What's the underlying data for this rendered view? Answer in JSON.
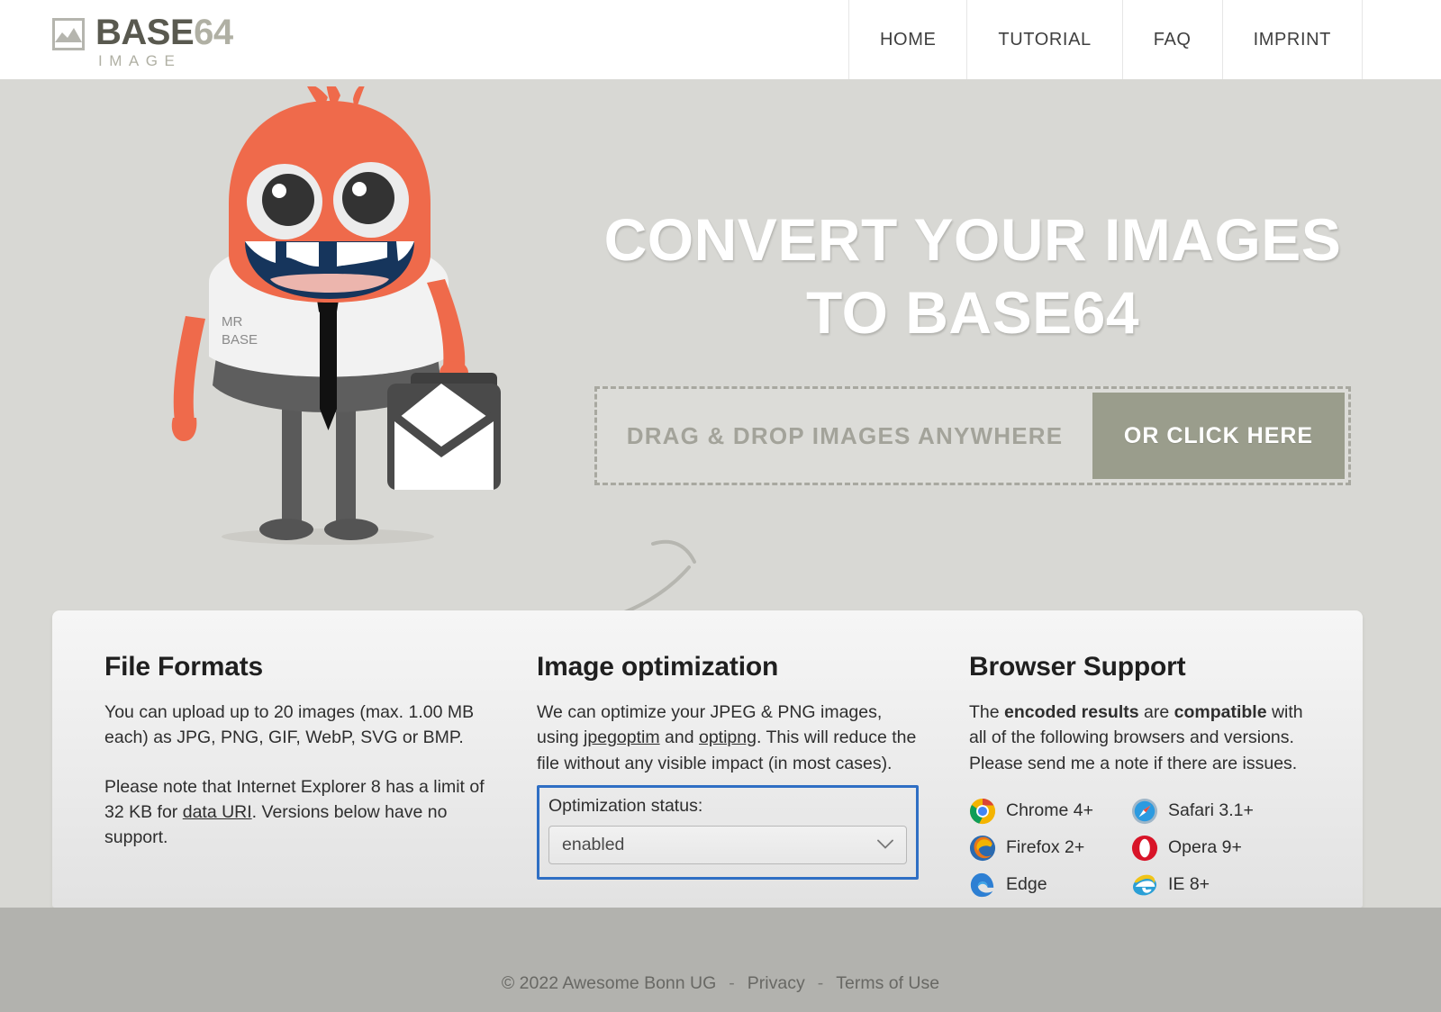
{
  "header": {
    "logo": {
      "icon": "image-frame-icon",
      "base": "BASE",
      "num": "64",
      "sub": "IMAGE"
    },
    "nav": [
      {
        "label": "HOME",
        "active": true
      },
      {
        "label": "TUTORIAL",
        "active": false
      },
      {
        "label": "FAQ",
        "active": false
      },
      {
        "label": "IMPRINT",
        "active": false
      }
    ]
  },
  "hero": {
    "title_line1": "CONVERT YOUR IMAGES",
    "title_line2": "TO BASE64",
    "mascot": {
      "alt": "mr-base-mascot",
      "shirt_line1": "MR",
      "shirt_line2": "BASE"
    },
    "dropzone": {
      "text": "DRAG & DROP IMAGES ANYWHERE",
      "button": "OR CLICK HERE"
    }
  },
  "card": {
    "file_formats": {
      "title": "File Formats",
      "p1": "You can upload up to 20 images (max. 1.00 MB each) as JPG, PNG, GIF, WebP, SVG or BMP.",
      "p2_before": "Please note that Internet Explorer 8 has a limit of 32 KB for ",
      "p2_link": "data URI",
      "p2_after": ". Versions below have no support."
    },
    "image_optimization": {
      "title": "Image optimization",
      "p1_a": "We can optimize your JPEG & PNG images, using ",
      "link1": "jpegoptim",
      "p1_b": " and ",
      "link2": "optipng",
      "p1_c": ". This will reduce the file without any visible impact (in most cases).",
      "select_label": "Optimization status:",
      "select_value": "enabled",
      "select_chevron": "chevron-down-icon"
    },
    "browser_support": {
      "title": "Browser Support",
      "p1_a": "The ",
      "b1": "encoded results",
      "p1_b": " are ",
      "b2": "compatible",
      "p1_c": " with all of the following browsers and versions. Please send me a note if there are issues.",
      "browsers": [
        {
          "icon": "chrome-icon",
          "label": "Chrome 4+"
        },
        {
          "icon": "safari-icon",
          "label": "Safari 3.1+"
        },
        {
          "icon": "firefox-icon",
          "label": "Firefox 2+"
        },
        {
          "icon": "opera-icon",
          "label": "Opera 9+"
        },
        {
          "icon": "edge-icon",
          "label": "Edge"
        },
        {
          "icon": "ie-icon",
          "label": "IE 8+"
        }
      ]
    }
  },
  "footer": {
    "copyright": "© 2022 Awesome Bonn UG",
    "sep1": "-",
    "privacy": "Privacy",
    "sep2": "-",
    "terms": "Terms of Use"
  },
  "colors": {
    "page_bg": "#d8d8d4",
    "header_bg": "#ffffff",
    "accent_button": "#9a9d8c",
    "focus_blue": "#2f6fc4",
    "footer_bg": "#b2b2ae",
    "mascot_orange": "#ef6a4b",
    "logo_gray": "#59594f"
  }
}
